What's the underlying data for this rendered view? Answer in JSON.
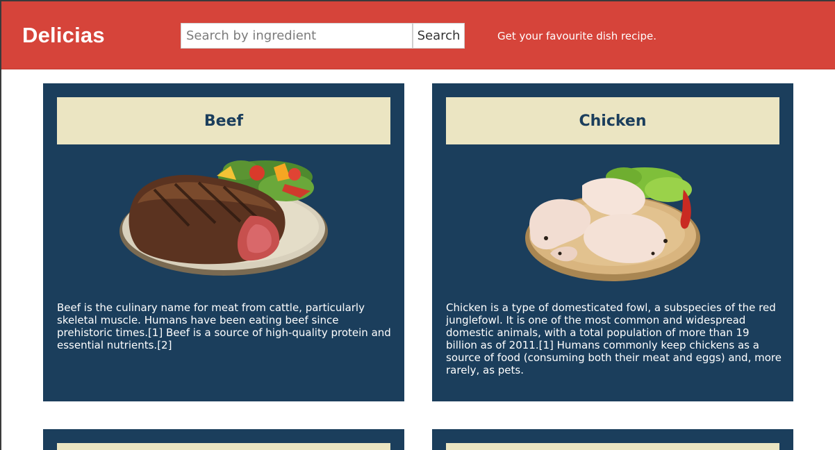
{
  "header": {
    "brand": "Delicias",
    "search_placeholder": "Search by ingredient",
    "search_button": "Search",
    "tagline": "Get your favourite dish recipe."
  },
  "cards": [
    {
      "title": "Beef",
      "description": "Beef is the culinary name for meat from cattle, particularly skeletal muscle. Humans have been eating beef since prehistoric times.[1] Beef is a source of high-quality protein and essential nutrients.[2]"
    },
    {
      "title": "Chicken",
      "description": "Chicken is a type of domesticated fowl, a subspecies of the red junglefowl. It is one of the most common and widespread domestic animals, with a total population of more than 19 billion as of 2011.[1] Humans commonly keep chickens as a source of food (consuming both their meat and eggs) and, more rarely, as pets."
    },
    {
      "title": "",
      "description": ""
    },
    {
      "title": "",
      "description": ""
    }
  ],
  "colors": {
    "header_bg": "#d6443a",
    "card_bg": "#1b3e5c",
    "title_bar_bg": "#ebe5c2"
  }
}
